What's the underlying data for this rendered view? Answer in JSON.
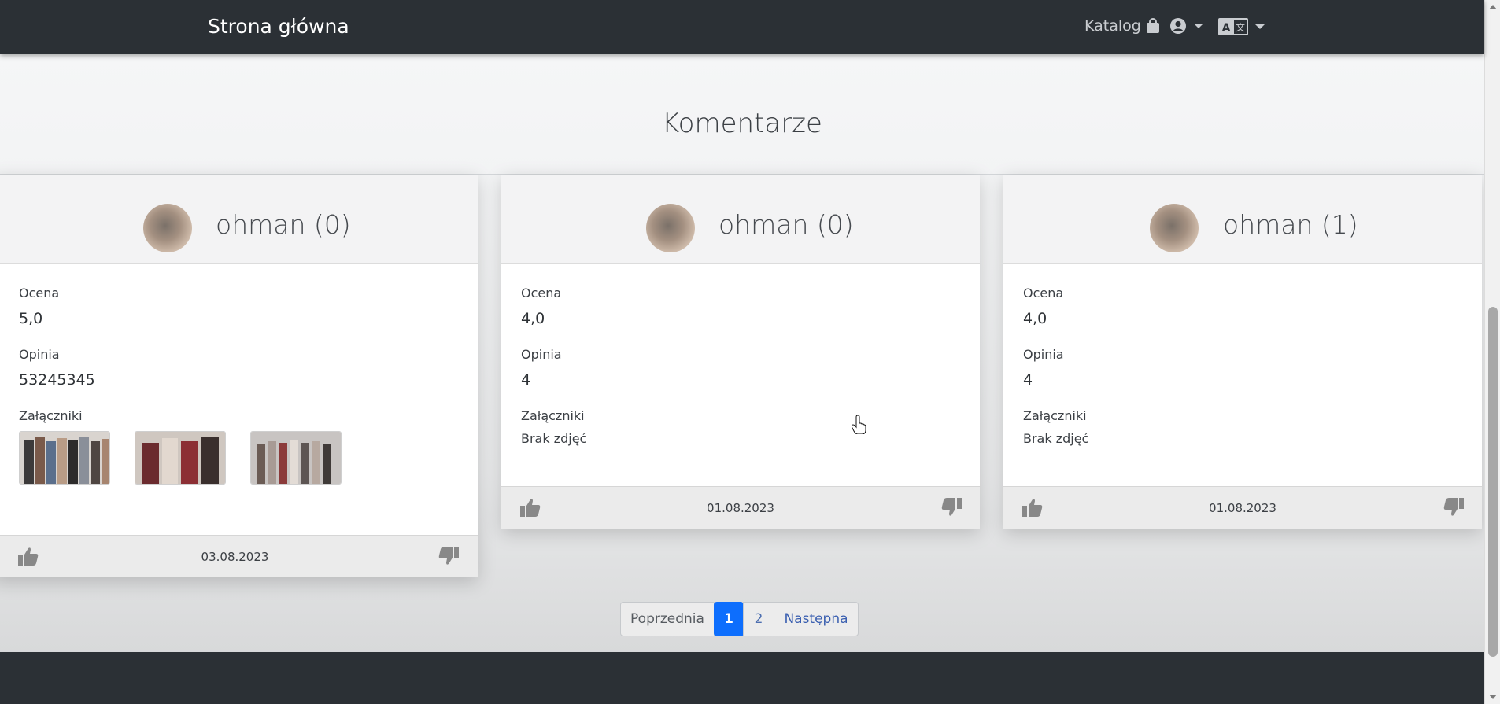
{
  "navbar": {
    "brand": "Strona główna",
    "catalog_label": "Katalog",
    "catalog_icon": "shopping-bag-icon",
    "user_icon": "user-circle-icon",
    "language_icon": "language-icon"
  },
  "main": {
    "section_title": "Komentarze"
  },
  "comments": [
    {
      "user": "ohman (0)",
      "rating_label": "Ocena",
      "rating": "5,0",
      "opinion_label": "Opinia",
      "opinion": "53245345",
      "attachments_label": "Załączniki",
      "attachments_note": "",
      "attachments_count": 3,
      "date": "03.08.2023"
    },
    {
      "user": "ohman (0)",
      "rating_label": "Ocena",
      "rating": "4,0",
      "opinion_label": "Opinia",
      "opinion": "4",
      "attachments_label": "Załączniki",
      "attachments_note": "Brak zdjęć",
      "attachments_count": 0,
      "date": "01.08.2023"
    },
    {
      "user": "ohman (1)",
      "rating_label": "Ocena",
      "rating": "4,0",
      "opinion_label": "Opinia",
      "opinion": "4",
      "attachments_label": "Załączniki",
      "attachments_note": "Brak zdjęć",
      "attachments_count": 0,
      "date": "01.08.2023"
    }
  ],
  "pagination": {
    "previous": "Poprzednia",
    "pages": [
      "1",
      "2"
    ],
    "current_page": "1",
    "next": "Następna"
  },
  "colors": {
    "navbar_bg": "#2b3035",
    "active_page": "#0d6efd",
    "link": "#3a5fb0"
  }
}
